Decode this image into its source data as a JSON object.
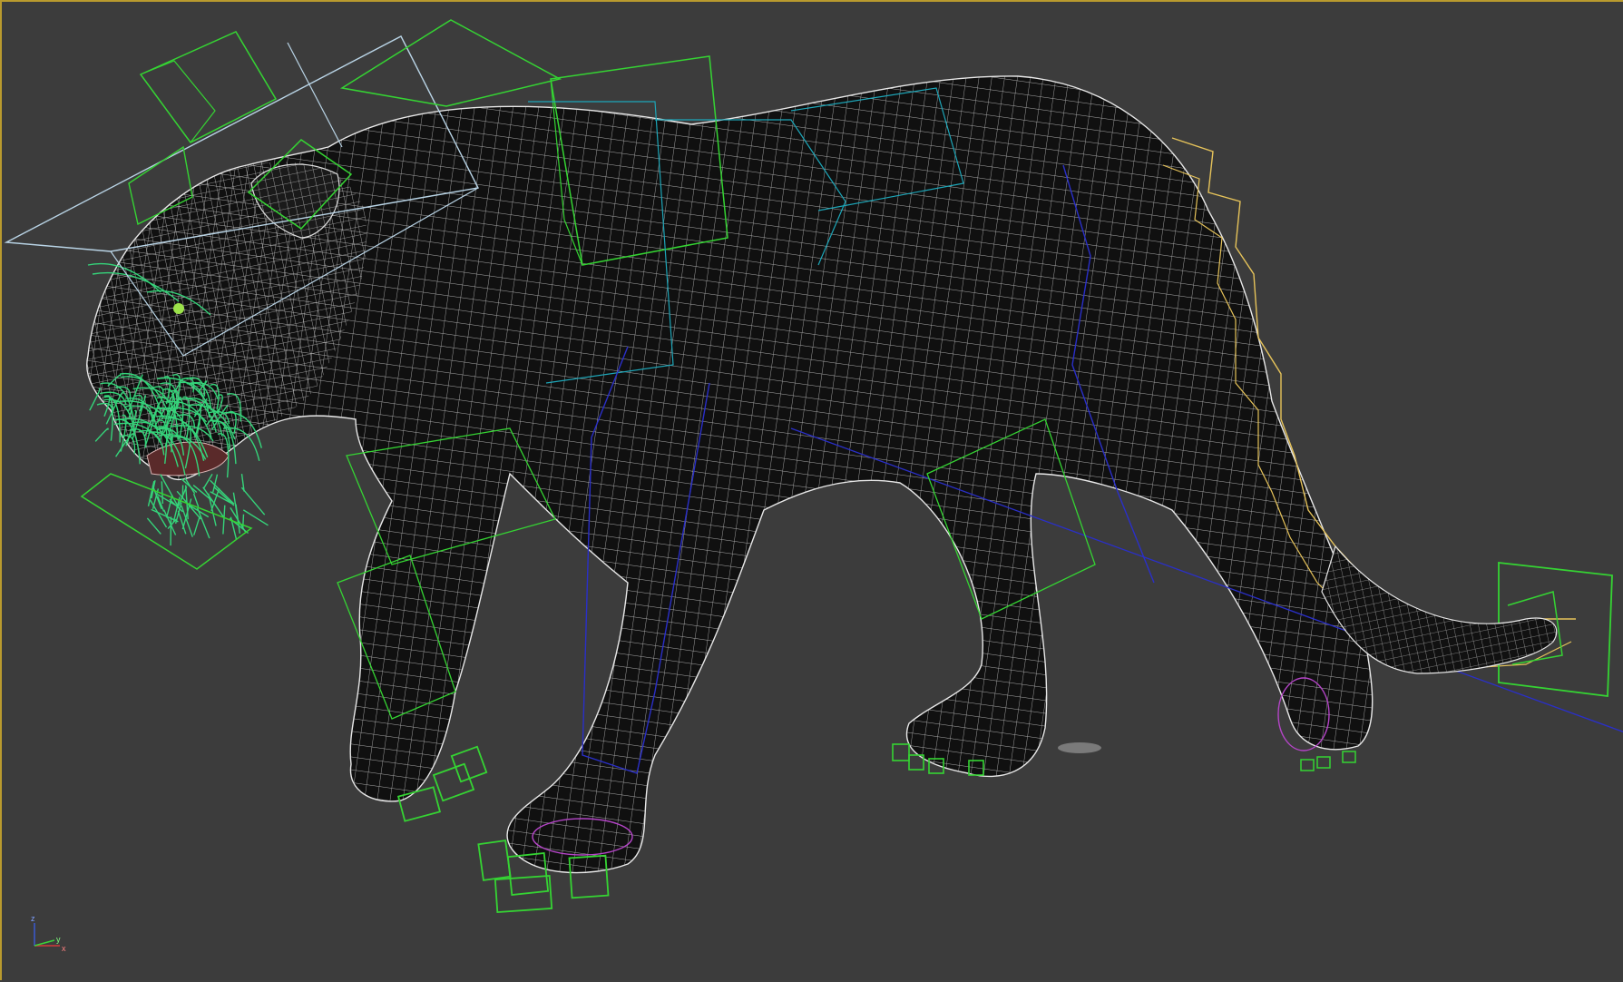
{
  "viewport": {
    "active_border_color": "#b99a2e",
    "background_color": "#3c3c3c",
    "display_mode": "wireframe-over-shaded"
  },
  "scene": {
    "subject": "panther-model",
    "mesh_color": "#0d0d0d",
    "wire_color": "#e6e6e6",
    "bone_colors": {
      "head_spine": "#35d433",
      "helper": "#b9d4e6",
      "spine_cyan": "#1da6b8",
      "tail": "#e6c35a",
      "leg_blue": "#2a2fc8",
      "paw_magenta": "#b545c8"
    }
  },
  "axis_gizmo": {
    "z_label": "z",
    "x_label": "x",
    "y_label": "y",
    "colors": {
      "x": "#d23a3a",
      "y": "#3ad23a",
      "z": "#3a5ad2"
    }
  }
}
